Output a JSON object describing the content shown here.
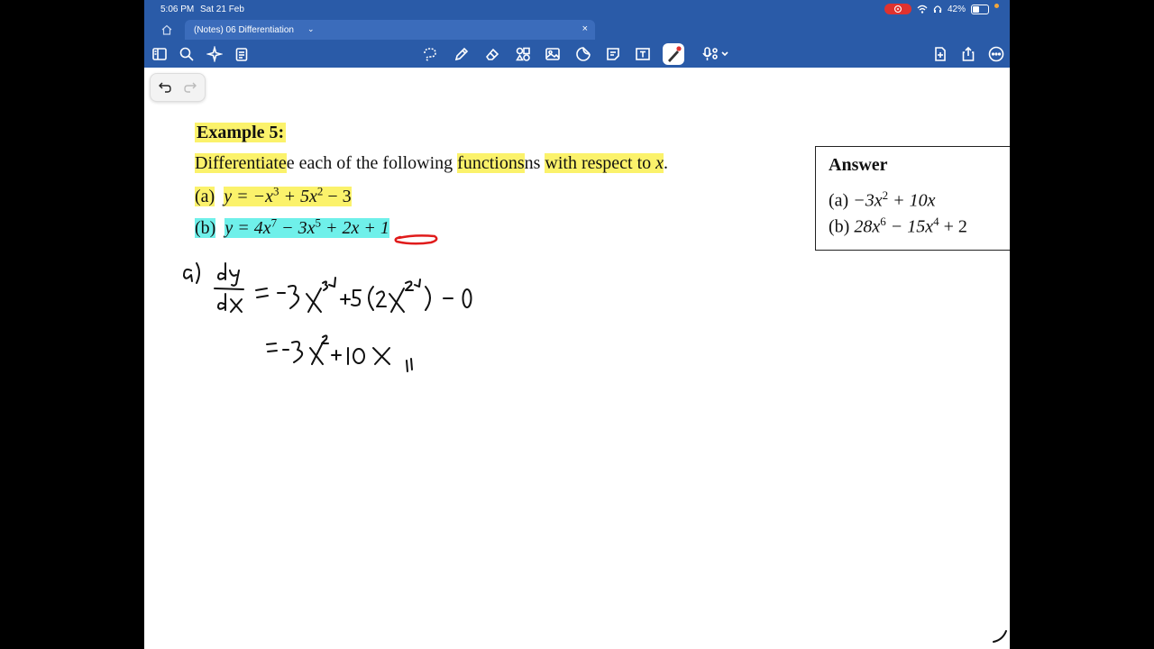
{
  "status": {
    "time": "5:06 PM",
    "date": "Sat 21 Feb",
    "battery": "42%"
  },
  "tab": {
    "title": "(Notes) 06 Differentiation",
    "chevron": "⌄",
    "close": "×"
  },
  "toolbar": {
    "left_icons": [
      "sidebar-icon",
      "search-icon",
      "sparkle-icon",
      "clipboard-icon"
    ],
    "center_icons": [
      "lasso-icon",
      "pen-icon",
      "eraser-icon",
      "shapes-icon",
      "image-icon",
      "sticker-icon",
      "sticky-note-icon",
      "text-box-icon",
      "laser-pointer-icon",
      "mic-icon"
    ],
    "right_icons": [
      "add-page-icon",
      "share-icon",
      "more-icon"
    ]
  },
  "example": {
    "title": "Example 5:",
    "instruction_p1": "Differentiate",
    "instruction_p2": "e each of the following ",
    "instruction_p3": "functions",
    "instruction_p4": "ns ",
    "instruction_p5": "with respect to ",
    "instruction_var": "x",
    "instruction_end": ".",
    "qa_label": "(a)",
    "qa_eq": "y = −x",
    "qa_e1": "3",
    "qa_mid": " + 5x",
    "qa_e2": "2",
    "qa_end": " − 3",
    "qb_label": "(b)",
    "qb_eq": "y = 4x",
    "qb_e1": "7",
    "qb_mid": " − 3x",
    "qb_e2": "5",
    "qb_end": " + 2x + 1"
  },
  "answer": {
    "title": "Answer",
    "a_label": "(a) ",
    "a_p1": "−3x",
    "a_e1": "2",
    "a_p2": " + 10x",
    "b_label": "(b) ",
    "b_p1": "28x",
    "b_e1": "6",
    "b_p2": " − 15x",
    "b_e2": "4",
    "b_p3": " + 2"
  },
  "colors": {
    "bar": "#2a5ba8",
    "highlight_yellow": "#fbf26b",
    "highlight_cyan": "#6ff0ea",
    "ink_red": "#e01b1b"
  }
}
